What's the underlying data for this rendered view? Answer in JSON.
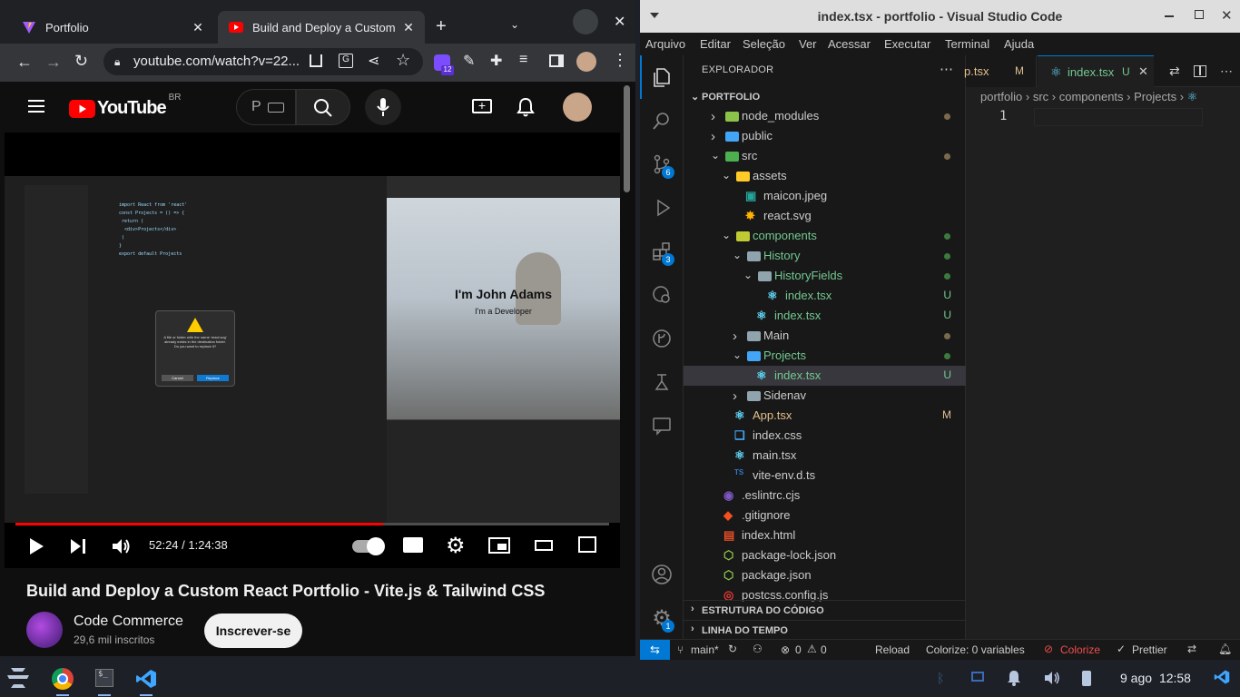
{
  "chrome": {
    "tabs": [
      {
        "title": "Portfolio",
        "icon": "vite-icon"
      },
      {
        "title": "Build and Deploy a Custom",
        "icon": "youtube-icon"
      }
    ],
    "url": "youtube.com/watch?v=22...",
    "extension_badge": "12"
  },
  "youtube": {
    "logo_text": "YouTube",
    "country": "BR",
    "search_placeholder": "P",
    "video": {
      "time": "52:24 / 1:24:38",
      "progress": 0.619,
      "inner": {
        "hero_name": "I'm John Adams",
        "hero_role": "I'm a Developer",
        "dialog_text": "A file or folder with the name 'react.svg' already exists in the destination folder. Do you want to replace it?",
        "dialog_cancel": "Cancel",
        "dialog_replace": "Replace"
      }
    },
    "title": "Build and Deploy a Custom React Portfolio - Vite.js & Tailwind CSS",
    "channel": "Code Commerce",
    "subscribers": "29,6 mil inscritos",
    "subscribe": "Inscrever-se"
  },
  "vscode": {
    "title": "index.tsx - portfolio - Visual Studio Code",
    "menu": [
      "Arquivo",
      "Editar",
      "Seleção",
      "Ver",
      "Acessar",
      "Executar",
      "Terminal",
      "Ajuda"
    ],
    "activity_badges": {
      "scm": "6",
      "extensions": "3",
      "accounts": "1"
    },
    "explorer_title": "EXPLORADOR",
    "root": "PORTFOLIO",
    "tree": [
      {
        "label": "node_modules",
        "depth": 0,
        "type": "folder",
        "collapsed": true,
        "icon_color": "#8bc34a",
        "dot": "#7a6a4d"
      },
      {
        "label": "public",
        "depth": 0,
        "type": "folder",
        "collapsed": true,
        "icon_color": "#42a5f5"
      },
      {
        "label": "src",
        "depth": 0,
        "type": "folder",
        "collapsed": false,
        "icon_color": "#4caf50",
        "dot": "#7a6a4d"
      },
      {
        "label": "assets",
        "depth": 1,
        "type": "folder",
        "collapsed": false,
        "icon_color": "#ffca28"
      },
      {
        "label": "maicon.jpeg",
        "depth": 2,
        "type": "image"
      },
      {
        "label": "react.svg",
        "depth": 2,
        "type": "svg"
      },
      {
        "label": "components",
        "depth": 1,
        "type": "folder",
        "collapsed": false,
        "icon_color": "#c0ca33",
        "dot": "#3d7a3d"
      },
      {
        "label": "History",
        "depth": 2,
        "type": "folder",
        "collapsed": false,
        "icon_color": "#90a4ae",
        "dot": "#3d7a3d"
      },
      {
        "label": "HistoryFields",
        "depth": 3,
        "type": "folder",
        "collapsed": false,
        "icon_color": "#90a4ae",
        "dot": "#3d7a3d"
      },
      {
        "label": "index.tsx",
        "depth": 4,
        "type": "react",
        "status": "U"
      },
      {
        "label": "index.tsx",
        "depth": 3,
        "type": "react",
        "status": "U"
      },
      {
        "label": "Main",
        "depth": 2,
        "type": "folder",
        "collapsed": true,
        "icon_color": "#90a4ae",
        "dot": "#7a6a4d"
      },
      {
        "label": "Projects",
        "depth": 2,
        "type": "folder",
        "collapsed": false,
        "icon_color": "#42a5f5",
        "dot": "#3d7a3d"
      },
      {
        "label": "index.tsx",
        "depth": 3,
        "type": "react",
        "status": "U",
        "selected": true
      },
      {
        "label": "Sidenav",
        "depth": 2,
        "type": "folder",
        "collapsed": true,
        "icon_color": "#90a4ae"
      },
      {
        "label": "App.tsx",
        "depth": 1,
        "type": "react",
        "status": "M"
      },
      {
        "label": "index.css",
        "depth": 1,
        "type": "css"
      },
      {
        "label": "main.tsx",
        "depth": 1,
        "type": "react"
      },
      {
        "label": "vite-env.d.ts",
        "depth": 1,
        "type": "ts"
      },
      {
        "label": ".eslintrc.cjs",
        "depth": 0,
        "type": "eslint"
      },
      {
        "label": ".gitignore",
        "depth": 0,
        "type": "git"
      },
      {
        "label": "index.html",
        "depth": 0,
        "type": "html"
      },
      {
        "label": "package-lock.json",
        "depth": 0,
        "type": "npm"
      },
      {
        "label": "package.json",
        "depth": 0,
        "type": "npm"
      },
      {
        "label": "postcss.config.js",
        "depth": 0,
        "type": "postcss"
      }
    ],
    "sections": [
      "ESTRUTURA DO CÓDIGO",
      "LINHA DO TEMPO"
    ],
    "tabs": [
      {
        "label": "p.tsx",
        "status": "M"
      },
      {
        "label": "index.tsx",
        "status": "U",
        "active": true
      }
    ],
    "breadcrumb": [
      "portfolio",
      "src",
      "components",
      "Projects"
    ],
    "line_number": "1",
    "status": {
      "branch": "main*",
      "errors": "0",
      "warnings": "0",
      "reload": "Reload",
      "colorize_vars": "Colorize: 0 variables",
      "colorize": "Colorize",
      "prettier": "Prettier"
    }
  },
  "taskbar": {
    "date": "9 ago",
    "time": "12:58"
  }
}
